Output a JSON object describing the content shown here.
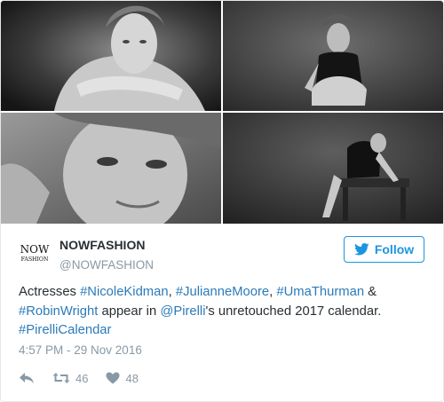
{
  "author": {
    "display_name": "NOWFASHION",
    "screen_name": "@NOWFASHION",
    "avatar_logo": {
      "line1": "NOW",
      "line2": "FASHION"
    }
  },
  "follow_button": {
    "label": "Follow",
    "icon": "twitter-bird-icon"
  },
  "tweet": {
    "segments": [
      {
        "type": "text",
        "text": "Actresses "
      },
      {
        "type": "link",
        "text": "#NicoleKidman"
      },
      {
        "type": "text",
        "text": ", "
      },
      {
        "type": "link",
        "text": "#JulianneMoore"
      },
      {
        "type": "text",
        "text": ", "
      },
      {
        "type": "link",
        "text": "#UmaThurman"
      },
      {
        "type": "text",
        "text": " & "
      },
      {
        "type": "link",
        "text": "#RobinWright"
      },
      {
        "type": "text",
        "text": " appear in "
      },
      {
        "type": "link",
        "text": "@Pirelli"
      },
      {
        "type": "text",
        "text": "'s unretouched 2017 calendar. "
      },
      {
        "type": "link",
        "text": "#PirelliCalendar"
      }
    ],
    "timestamp": "4:57 PM - 29 Nov 2016"
  },
  "actions": {
    "reply_icon": "reply-icon",
    "retweet_icon": "retweet-icon",
    "retweet_count": "46",
    "like_icon": "heart-icon",
    "like_count": "48"
  },
  "colors": {
    "link": "#2b7bb9",
    "follow_accent": "#1b95e0",
    "muted": "#8899a6",
    "text": "#292f33"
  }
}
